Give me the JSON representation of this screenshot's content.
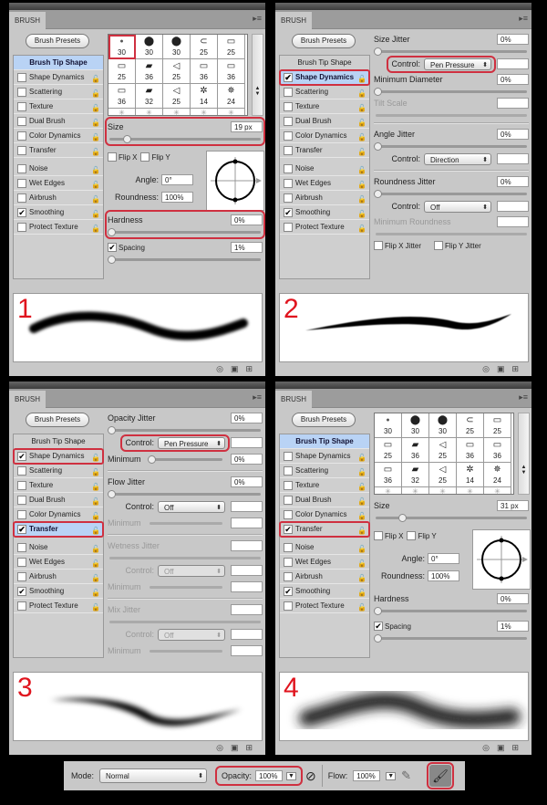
{
  "tip_values": [
    "30",
    "30",
    "30",
    "25",
    "25",
    "25",
    "36",
    "25",
    "36",
    "36",
    "36",
    "32",
    "25",
    "14",
    "24"
  ],
  "panels": [
    {
      "number": "1",
      "title": "BRUSH",
      "presets_label": "Brush Presets",
      "kind": "tip",
      "options": [
        {
          "label": "Brush Tip Shape",
          "head": true,
          "selected": true
        },
        {
          "label": "Shape Dynamics",
          "checked": false
        },
        {
          "label": "Scattering",
          "checked": false
        },
        {
          "label": "Texture",
          "checked": false
        },
        {
          "label": "Dual Brush",
          "checked": false
        },
        {
          "label": "Color Dynamics",
          "checked": false
        },
        {
          "label": "Transfer",
          "checked": false
        },
        {
          "label": "Noise",
          "checked": false,
          "gap": true
        },
        {
          "label": "Wet Edges",
          "checked": false
        },
        {
          "label": "Airbrush",
          "checked": false
        },
        {
          "label": "Smoothing",
          "checked": true
        },
        {
          "label": "Protect Texture",
          "checked": false
        }
      ],
      "tip": {
        "size_label": "Size",
        "size": "19 px",
        "size_pct": 10,
        "flip_x": "Flip X",
        "flip_y": "Flip Y",
        "angle_label": "Angle:",
        "angle": "0°",
        "roundness_label": "Roundness:",
        "roundness": "100%",
        "hardness_label": "Hardness",
        "hardness": "0%",
        "spacing_label": "Spacing",
        "spacing": "1%",
        "spacing_checked": true,
        "highlight_size": true,
        "highlight_hardness": true,
        "highlight_tip": true
      }
    },
    {
      "number": "2",
      "title": "BRUSH",
      "presets_label": "Brush Presets",
      "kind": "rows",
      "options": [
        {
          "label": "Brush Tip Shape",
          "head": true
        },
        {
          "label": "Shape Dynamics",
          "checked": true,
          "selected": true,
          "highlight": true
        },
        {
          "label": "Scattering",
          "checked": false
        },
        {
          "label": "Texture",
          "checked": false
        },
        {
          "label": "Dual Brush",
          "checked": false
        },
        {
          "label": "Color Dynamics",
          "checked": false
        },
        {
          "label": "Transfer",
          "checked": false
        },
        {
          "label": "Noise",
          "checked": false,
          "gap": true
        },
        {
          "label": "Wet Edges",
          "checked": false
        },
        {
          "label": "Airbrush",
          "checked": false
        },
        {
          "label": "Smoothing",
          "checked": true
        },
        {
          "label": "Protect Texture",
          "checked": false
        }
      ],
      "rows": [
        {
          "type": "label",
          "label": "Size Jitter",
          "value": "0%"
        },
        {
          "type": "slider"
        },
        {
          "type": "control",
          "label": "Control:",
          "value": "Pen Pressure",
          "highlight": true
        },
        {
          "type": "label",
          "label": "Minimum Diameter",
          "value": "0%"
        },
        {
          "type": "slider"
        },
        {
          "type": "label",
          "label": "Tilt Scale",
          "value": "",
          "disabled": true
        },
        {
          "type": "slider",
          "disabled": true
        },
        {
          "type": "divider"
        },
        {
          "type": "label",
          "label": "Angle Jitter",
          "value": "0%"
        },
        {
          "type": "slider"
        },
        {
          "type": "control",
          "label": "Control:",
          "value": "Direction"
        },
        {
          "type": "divider"
        },
        {
          "type": "label",
          "label": "Roundness Jitter",
          "value": "0%"
        },
        {
          "type": "slider"
        },
        {
          "type": "control",
          "label": "Control:",
          "value": "Off"
        },
        {
          "type": "label",
          "label": "Minimum Roundness",
          "value": "",
          "disabled": true
        },
        {
          "type": "slider",
          "disabled": true
        },
        {
          "type": "checks",
          "items": [
            "Flip X Jitter",
            "Flip Y Jitter"
          ]
        }
      ]
    },
    {
      "number": "3",
      "title": "BRUSH",
      "presets_label": "Brush Presets",
      "kind": "rows",
      "options": [
        {
          "label": "Brush Tip Shape",
          "head": true
        },
        {
          "label": "Shape Dynamics",
          "checked": true,
          "highlight": true
        },
        {
          "label": "Scattering",
          "checked": false
        },
        {
          "label": "Texture",
          "checked": false
        },
        {
          "label": "Dual Brush",
          "checked": false
        },
        {
          "label": "Color Dynamics",
          "checked": false
        },
        {
          "label": "Transfer",
          "checked": true,
          "selected": true,
          "highlight": true
        },
        {
          "label": "Noise",
          "checked": false,
          "gap": true
        },
        {
          "label": "Wet Edges",
          "checked": false
        },
        {
          "label": "Airbrush",
          "checked": false
        },
        {
          "label": "Smoothing",
          "checked": true
        },
        {
          "label": "Protect Texture",
          "checked": false
        }
      ],
      "rows": [
        {
          "type": "label",
          "label": "Opacity Jitter",
          "value": "0%"
        },
        {
          "type": "slider"
        },
        {
          "type": "control",
          "label": "Control:",
          "value": "Pen Pressure",
          "highlight": true
        },
        {
          "type": "minslider",
          "label": "Minimum",
          "value": "0%"
        },
        {
          "type": "divider"
        },
        {
          "type": "label",
          "label": "Flow Jitter",
          "value": "0%"
        },
        {
          "type": "slider"
        },
        {
          "type": "control",
          "label": "Control:",
          "value": "Off"
        },
        {
          "type": "minslider",
          "label": "Minimum",
          "value": "",
          "disabled": true
        },
        {
          "type": "divider"
        },
        {
          "type": "label",
          "label": "Wetness Jitter",
          "value": "",
          "disabled": true
        },
        {
          "type": "slider",
          "disabled": true
        },
        {
          "type": "control",
          "label": "Control:",
          "value": "Off",
          "disabled": true
        },
        {
          "type": "minslider",
          "label": "Minimum",
          "value": "",
          "disabled": true
        },
        {
          "type": "divider"
        },
        {
          "type": "label",
          "label": "Mix Jitter",
          "value": "",
          "disabled": true
        },
        {
          "type": "slider",
          "disabled": true
        },
        {
          "type": "control",
          "label": "Control:",
          "value": "Off",
          "disabled": true
        },
        {
          "type": "minslider",
          "label": "Minimum",
          "value": "",
          "disabled": true
        }
      ]
    },
    {
      "number": "4",
      "title": "BRUSH",
      "presets_label": "Brush Presets",
      "kind": "tip",
      "options": [
        {
          "label": "Brush Tip Shape",
          "head": true,
          "selected": true
        },
        {
          "label": "Shape Dynamics",
          "checked": false
        },
        {
          "label": "Scattering",
          "checked": false
        },
        {
          "label": "Texture",
          "checked": false
        },
        {
          "label": "Dual Brush",
          "checked": false
        },
        {
          "label": "Color Dynamics",
          "checked": false
        },
        {
          "label": "Transfer",
          "checked": true,
          "highlight": true
        },
        {
          "label": "Noise",
          "checked": false,
          "gap": true
        },
        {
          "label": "Wet Edges",
          "checked": false
        },
        {
          "label": "Airbrush",
          "checked": false
        },
        {
          "label": "Smoothing",
          "checked": true
        },
        {
          "label": "Protect Texture",
          "checked": false
        }
      ],
      "tip": {
        "size_label": "Size",
        "size": "31 px",
        "size_pct": 16,
        "flip_x": "Flip X",
        "flip_y": "Flip Y",
        "angle_label": "Angle:",
        "angle": "0°",
        "roundness_label": "Roundness:",
        "roundness": "100%",
        "hardness_label": "Hardness",
        "hardness": "0%",
        "spacing_label": "Spacing",
        "spacing": "1%",
        "spacing_checked": true
      }
    }
  ],
  "toolbar": {
    "mode_label": "Mode:",
    "mode_value": "Normal",
    "opacity_label": "Opacity:",
    "opacity_value": "100%",
    "flow_label": "Flow:",
    "flow_value": "100%"
  },
  "colors": {
    "highlight": "#cf3040",
    "number": "#e0141e",
    "selected": "#b9d3f5"
  }
}
